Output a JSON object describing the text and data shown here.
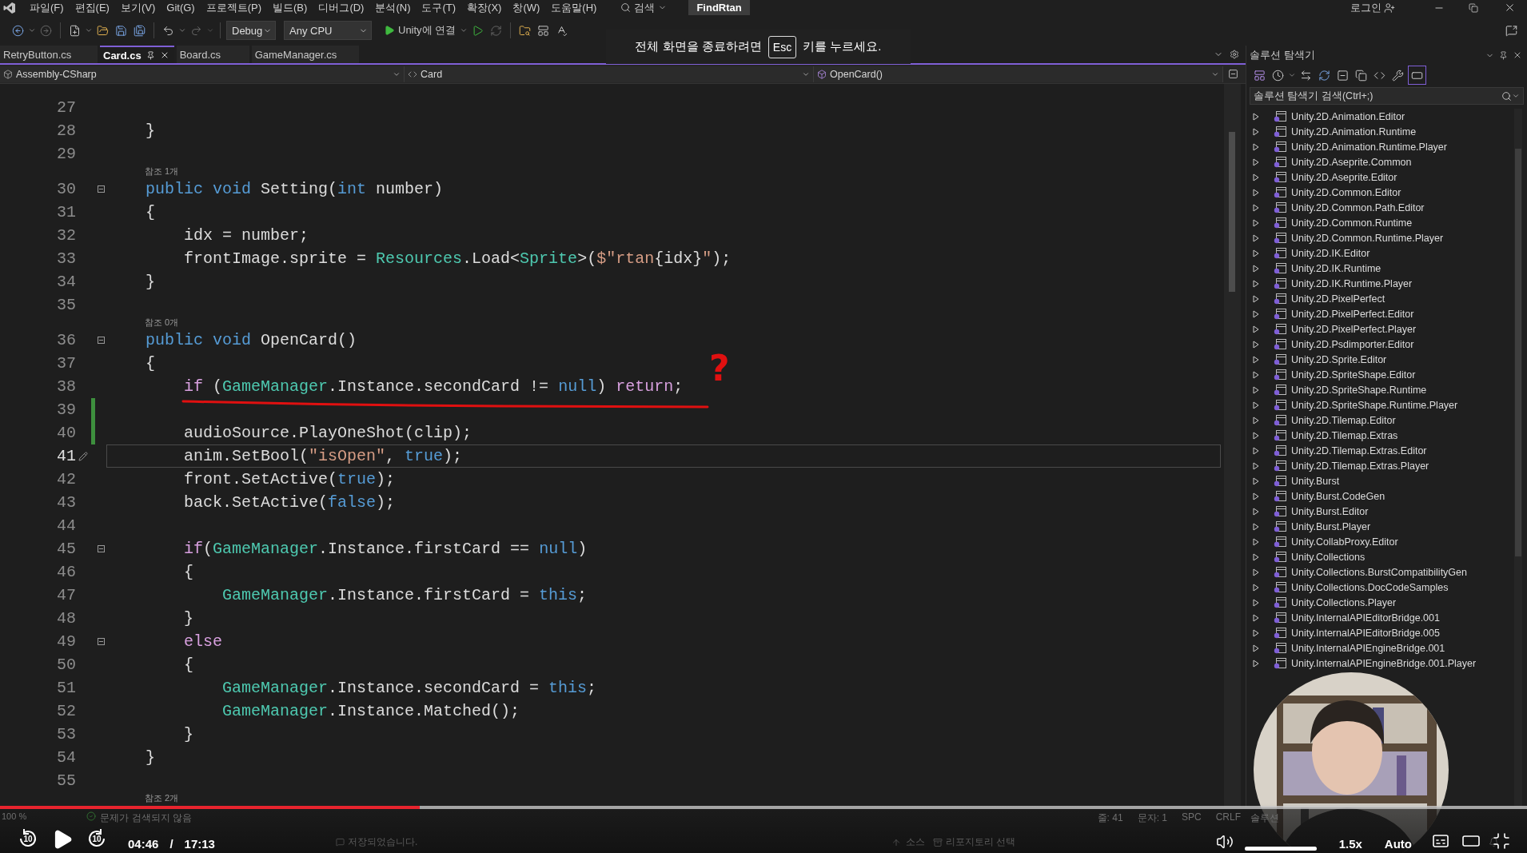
{
  "menu_bar": {
    "items": [
      "파일(F)",
      "편집(E)",
      "보기(V)",
      "Git(G)",
      "프로젝트(P)",
      "빌드(B)",
      "디버그(D)",
      "분석(N)",
      "도구(T)",
      "확장(X)",
      "창(W)",
      "도움말(H)"
    ],
    "search": "검색",
    "solution_name": "FindRtan",
    "login": "로그인"
  },
  "toolbar": {
    "configuration": "Debug",
    "platform": "Any CPU",
    "run_target": "Unity에 연결"
  },
  "fullscreen_notice": {
    "before": "전체 화면을 종료하려면",
    "key": "Esc",
    "after": "키를 누르세요."
  },
  "editor": {
    "tabs": [
      {
        "label": "RetryButton.cs",
        "selected": false
      },
      {
        "label": "Card.cs",
        "selected": true
      },
      {
        "label": "Board.cs",
        "selected": false
      },
      {
        "label": "GameManager.cs",
        "selected": false
      }
    ],
    "navigation": {
      "project": "Assembly-CSharp",
      "type": "Card",
      "member": "OpenCard()"
    },
    "lines": [
      {
        "kind": "code",
        "number": "27",
        "fold": false,
        "changed": false,
        "current": false
      },
      {
        "kind": "code",
        "number": "28",
        "tokens": [
          {
            "text": "    }",
            "kind": "plain"
          }
        ],
        "fold": false,
        "changed": false,
        "current": false
      },
      {
        "kind": "code",
        "number": "29",
        "fold": false,
        "changed": false,
        "current": false
      },
      {
        "kind": "codelens",
        "text": "참조 1개"
      },
      {
        "kind": "code",
        "number": "30",
        "tokens": [
          {
            "text": "    public",
            "kind": "keyword"
          },
          {
            "text": " void",
            "kind": "keyword"
          },
          {
            "text": " Setting(",
            "kind": "plain"
          },
          {
            "text": "int",
            "kind": "keyword"
          },
          {
            "text": " number)",
            "kind": "plain"
          }
        ],
        "fold": true,
        "changed": false,
        "current": false
      },
      {
        "kind": "code",
        "number": "31",
        "tokens": [
          {
            "text": "    {",
            "kind": "plain"
          }
        ],
        "fold": false,
        "changed": false,
        "current": false
      },
      {
        "kind": "code",
        "number": "32",
        "tokens": [
          {
            "text": "        idx = number;",
            "kind": "plain"
          }
        ],
        "fold": false,
        "changed": false,
        "current": false
      },
      {
        "kind": "code",
        "number": "33",
        "tokens": [
          {
            "text": "        frontImage.sprite = ",
            "kind": "plain"
          },
          {
            "text": "Resources",
            "kind": "type"
          },
          {
            "text": ".Load<",
            "kind": "plain"
          },
          {
            "text": "Sprite",
            "kind": "type"
          },
          {
            "text": ">(",
            "kind": "plain"
          },
          {
            "text": "$\"rtan",
            "kind": "string"
          },
          {
            "text": "{idx}",
            "kind": "plain"
          },
          {
            "text": "\"",
            "kind": "string"
          },
          {
            "text": ");",
            "kind": "plain"
          }
        ],
        "fold": false,
        "changed": false,
        "current": false
      },
      {
        "kind": "code",
        "number": "34",
        "tokens": [
          {
            "text": "    }",
            "kind": "plain"
          }
        ],
        "fold": false,
        "changed": false,
        "current": false
      },
      {
        "kind": "code",
        "number": "35",
        "fold": false,
        "changed": false,
        "current": false
      },
      {
        "kind": "codelens",
        "text": "참조 0개"
      },
      {
        "kind": "code",
        "number": "36",
        "tokens": [
          {
            "text": "    public",
            "kind": "keyword"
          },
          {
            "text": " void",
            "kind": "keyword"
          },
          {
            "text": " OpenCard()",
            "kind": "plain"
          }
        ],
        "fold": true,
        "changed": false,
        "current": false
      },
      {
        "kind": "code",
        "number": "37",
        "tokens": [
          {
            "text": "    {",
            "kind": "plain"
          }
        ],
        "fold": false,
        "changed": false,
        "current": false
      },
      {
        "kind": "code",
        "number": "38",
        "tokens": [
          {
            "text": "        if",
            "kind": "control"
          },
          {
            "text": " (",
            "kind": "plain"
          },
          {
            "text": "GameManager",
            "kind": "type"
          },
          {
            "text": ".Instance.secondCard != ",
            "kind": "plain"
          },
          {
            "text": "null",
            "kind": "keyword"
          },
          {
            "text": ") ",
            "kind": "plain"
          },
          {
            "text": "return",
            "kind": "control"
          },
          {
            "text": ";",
            "kind": "plain"
          }
        ],
        "fold": false,
        "changed": false,
        "current": false,
        "annotation": "?"
      },
      {
        "kind": "code",
        "number": "39",
        "fold": false,
        "changed": true,
        "current": false
      },
      {
        "kind": "code",
        "number": "40",
        "tokens": [
          {
            "text": "        audioSource.PlayOneShot(clip);",
            "kind": "plain"
          }
        ],
        "fold": false,
        "changed": true,
        "current": false
      },
      {
        "kind": "code",
        "number": "41",
        "tokens": [
          {
            "text": "        anim.SetBool(",
            "kind": "plain"
          },
          {
            "text": "\"isOpen\"",
            "kind": "string"
          },
          {
            "text": ", ",
            "kind": "plain"
          },
          {
            "text": "true",
            "kind": "keyword"
          },
          {
            "text": ");",
            "kind": "plain"
          }
        ],
        "fold": false,
        "changed": false,
        "current": true
      },
      {
        "kind": "code",
        "number": "42",
        "tokens": [
          {
            "text": "        front.SetActive(",
            "kind": "plain"
          },
          {
            "text": "true",
            "kind": "keyword"
          },
          {
            "text": ");",
            "kind": "plain"
          }
        ],
        "fold": false,
        "changed": false,
        "current": false
      },
      {
        "kind": "code",
        "number": "43",
        "tokens": [
          {
            "text": "        back.SetActive(",
            "kind": "plain"
          },
          {
            "text": "false",
            "kind": "keyword"
          },
          {
            "text": ");",
            "kind": "plain"
          }
        ],
        "fold": false,
        "changed": false,
        "current": false
      },
      {
        "kind": "code",
        "number": "44",
        "fold": false,
        "changed": false,
        "current": false
      },
      {
        "kind": "code",
        "number": "45",
        "tokens": [
          {
            "text": "        if",
            "kind": "control"
          },
          {
            "text": "(",
            "kind": "plain"
          },
          {
            "text": "GameManager",
            "kind": "type"
          },
          {
            "text": ".Instance.firstCard == ",
            "kind": "plain"
          },
          {
            "text": "null",
            "kind": "keyword"
          },
          {
            "text": ")",
            "kind": "plain"
          }
        ],
        "fold": true,
        "changed": false,
        "current": false
      },
      {
        "kind": "code",
        "number": "46",
        "tokens": [
          {
            "text": "        {",
            "kind": "plain"
          }
        ],
        "fold": false,
        "changed": false,
        "current": false
      },
      {
        "kind": "code",
        "number": "47",
        "tokens": [
          {
            "text": "            GameManager",
            "kind": "type"
          },
          {
            "text": ".Instance.firstCard = ",
            "kind": "plain"
          },
          {
            "text": "this",
            "kind": "keyword"
          },
          {
            "text": ";",
            "kind": "plain"
          }
        ],
        "fold": false,
        "changed": false,
        "current": false
      },
      {
        "kind": "code",
        "number": "48",
        "tokens": [
          {
            "text": "        }",
            "kind": "plain"
          }
        ],
        "fold": false,
        "changed": false,
        "current": false
      },
      {
        "kind": "code",
        "number": "49",
        "tokens": [
          {
            "text": "        else",
            "kind": "control"
          }
        ],
        "fold": true,
        "changed": false,
        "current": false
      },
      {
        "kind": "code",
        "number": "50",
        "tokens": [
          {
            "text": "        {",
            "kind": "plain"
          }
        ],
        "fold": false,
        "changed": false,
        "current": false
      },
      {
        "kind": "code",
        "number": "51",
        "tokens": [
          {
            "text": "            GameManager",
            "kind": "type"
          },
          {
            "text": ".Instance.secondCard = ",
            "kind": "plain"
          },
          {
            "text": "this",
            "kind": "keyword"
          },
          {
            "text": ";",
            "kind": "plain"
          }
        ],
        "fold": false,
        "changed": false,
        "current": false
      },
      {
        "kind": "code",
        "number": "52",
        "tokens": [
          {
            "text": "            GameManager",
            "kind": "type"
          },
          {
            "text": ".Instance.Matched();",
            "kind": "plain"
          }
        ],
        "fold": false,
        "changed": false,
        "current": false
      },
      {
        "kind": "code",
        "number": "53",
        "tokens": [
          {
            "text": "        }",
            "kind": "plain"
          }
        ],
        "fold": false,
        "changed": false,
        "current": false
      },
      {
        "kind": "code",
        "number": "54",
        "tokens": [
          {
            "text": "    }",
            "kind": "plain"
          }
        ],
        "fold": false,
        "changed": false,
        "current": false
      },
      {
        "kind": "code",
        "number": "55",
        "fold": false,
        "changed": false,
        "current": false
      },
      {
        "kind": "codelens",
        "text": "참조 2개"
      }
    ]
  },
  "explorer": {
    "title": "솔루션 탐색기",
    "search_placeholder": "솔루션 탐색기 검색(Ctrl+;)",
    "items": [
      {
        "label": "Unity.2D.Animation.Editor",
        "expanded": false
      },
      {
        "label": "Unity.2D.Animation.Runtime",
        "expanded": false
      },
      {
        "label": "Unity.2D.Animation.Runtime.Player",
        "expanded": false
      },
      {
        "label": "Unity.2D.Aseprite.Common",
        "expanded": false
      },
      {
        "label": "Unity.2D.Aseprite.Editor",
        "expanded": false
      },
      {
        "label": "Unity.2D.Common.Editor",
        "expanded": false
      },
      {
        "label": "Unity.2D.Common.Path.Editor",
        "expanded": false
      },
      {
        "label": "Unity.2D.Common.Runtime",
        "expanded": false
      },
      {
        "label": "Unity.2D.Common.Runtime.Player",
        "expanded": false
      },
      {
        "label": "Unity.2D.IK.Editor",
        "expanded": false
      },
      {
        "label": "Unity.2D.IK.Runtime",
        "expanded": false
      },
      {
        "label": "Unity.2D.IK.Runtime.Player",
        "expanded": false
      },
      {
        "label": "Unity.2D.PixelPerfect",
        "expanded": false
      },
      {
        "label": "Unity.2D.PixelPerfect.Editor",
        "expanded": false
      },
      {
        "label": "Unity.2D.PixelPerfect.Player",
        "expanded": false
      },
      {
        "label": "Unity.2D.Psdimporter.Editor",
        "expanded": false
      },
      {
        "label": "Unity.2D.Sprite.Editor",
        "expanded": false
      },
      {
        "label": "Unity.2D.SpriteShape.Editor",
        "expanded": false
      },
      {
        "label": "Unity.2D.SpriteShape.Runtime",
        "expanded": false
      },
      {
        "label": "Unity.2D.SpriteShape.Runtime.Player",
        "expanded": false
      },
      {
        "label": "Unity.2D.Tilemap.Editor",
        "expanded": false
      },
      {
        "label": "Unity.2D.Tilemap.Extras",
        "expanded": false
      },
      {
        "label": "Unity.2D.Tilemap.Extras.Editor",
        "expanded": false
      },
      {
        "label": "Unity.2D.Tilemap.Extras.Player",
        "expanded": false
      },
      {
        "label": "Unity.Burst",
        "expanded": false
      },
      {
        "label": "Unity.Burst.CodeGen",
        "expanded": false
      },
      {
        "label": "Unity.Burst.Editor",
        "expanded": false
      },
      {
        "label": "Unity.Burst.Player",
        "expanded": false
      },
      {
        "label": "Unity.CollabProxy.Editor",
        "expanded": false
      },
      {
        "label": "Unity.Collections",
        "expanded": false
      },
      {
        "label": "Unity.Collections.BurstCompatibilityGen",
        "expanded": false
      },
      {
        "label": "Unity.Collections.DocCodeSamples",
        "expanded": false
      },
      {
        "label": "Unity.Collections.Player",
        "expanded": false
      },
      {
        "label": "Unity.InternalAPIEditorBridge.001",
        "expanded": false
      },
      {
        "label": "Unity.InternalAPIEditorBridge.005",
        "expanded": false
      },
      {
        "label": "Unity.InternalAPIEngineBridge.001",
        "expanded": false
      },
      {
        "label": "Unity.InternalAPIEngineBridge.001.Player",
        "expanded": false
      }
    ]
  },
  "status_bar": {
    "zoom": "100 %",
    "issues": "문제가 검색되지 않음",
    "line": "줄: 41",
    "column": "문자: 1",
    "whitespace": "SPC",
    "line_ending": "CRLF",
    "panel_tab": "솔루션",
    "message": "저장되었습니다.",
    "source_control": "소스",
    "repository": "리포지토리 선택"
  },
  "player": {
    "progress": {
      "level": 0.275
    },
    "rewind": "10",
    "forward": "10",
    "playing": false,
    "current_time": "04:46",
    "separator": "/",
    "duration": "17:13",
    "volume": {
      "level": 1.0
    },
    "speed": "1.5x",
    "quality": "Auto"
  }
}
